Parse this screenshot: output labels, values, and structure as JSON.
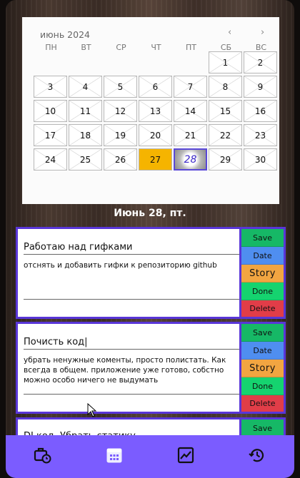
{
  "calendar": {
    "month_label": "июнь 2024",
    "prev": "‹",
    "next": "›",
    "weekdays": [
      "ПН",
      "ВТ",
      "СР",
      "ЧТ",
      "ПТ",
      "СБ",
      "ВС"
    ],
    "weeks": [
      [
        "",
        "",
        "",
        "",
        "",
        "1",
        "2"
      ],
      [
        "3",
        "4",
        "5",
        "6",
        "7",
        "8",
        "9"
      ],
      [
        "10",
        "11",
        "12",
        "13",
        "14",
        "15",
        "16"
      ],
      [
        "17",
        "18",
        "19",
        "20",
        "21",
        "22",
        "23"
      ],
      [
        "24",
        "25",
        "26",
        "27",
        "28",
        "29",
        "30"
      ]
    ],
    "today": "27",
    "selected": "28",
    "colors": {
      "today": "#f5b400",
      "selected_border": "#5a48d8"
    }
  },
  "date_heading": "Июнь 28, пт.",
  "buttons": {
    "save": "Save",
    "date": "Date",
    "story": "Story",
    "done": "Done",
    "delete": "Delete",
    "colors": {
      "save": "#16b866",
      "date": "#4f8ef0",
      "story": "#f2a541",
      "done": "#15d36f",
      "delete": "#e13d48"
    }
  },
  "tasks": [
    {
      "title": "Работаю над гифками",
      "description": "отснять и добавить гифки к репозиторию github"
    },
    {
      "title": "Почисть код|",
      "description": "убрать ненужные коменты, просто полистать. Как всегда в общем. приложение уже готово, собстно можно особо ничего не выдумать"
    },
    {
      "title": "DI код. Убрать статику"
    }
  ],
  "nav": {
    "icons": [
      "briefcase-clock-icon",
      "calendar-icon",
      "chart-icon",
      "history-icon"
    ],
    "bar_color": "#7b5cff"
  }
}
